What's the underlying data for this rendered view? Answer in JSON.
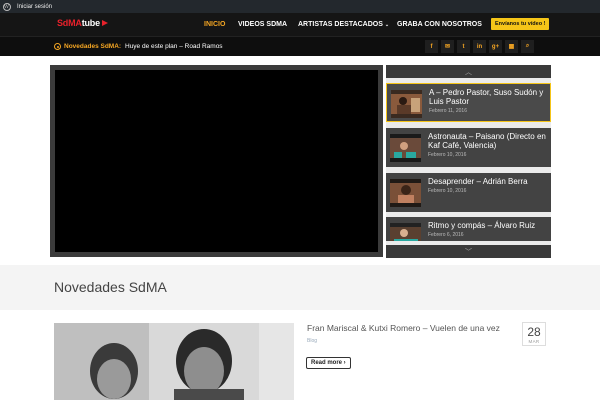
{
  "adminbar": {
    "login": "Iniciar sesión",
    "icon": "wordpress-icon"
  },
  "header": {
    "logo_a": "SdMA",
    "logo_b": "tube",
    "nav": [
      {
        "label": "INICIO",
        "active": true
      },
      {
        "label": "VIDEOS SDMA",
        "active": false
      },
      {
        "label": "ARTISTAS DESTACADOS",
        "active": false,
        "dropdown": true
      },
      {
        "label": "GRABA CON NOSOTROS",
        "active": false
      }
    ],
    "cta": "Envíanos tu vídeo !"
  },
  "ticker": {
    "label": "Novedades SdMA:",
    "text": "Huye de este plan – Road Ramos",
    "social": [
      {
        "icon": "facebook-icon",
        "glyph": "f"
      },
      {
        "icon": "mail-icon",
        "glyph": "✉"
      },
      {
        "icon": "twitter-icon",
        "glyph": "t"
      },
      {
        "icon": "linkedin-icon",
        "glyph": "in"
      },
      {
        "icon": "google-plus-icon",
        "glyph": "g+"
      },
      {
        "icon": "grid-icon",
        "glyph": "▦"
      },
      {
        "icon": "search-icon",
        "glyph": "⌕"
      }
    ]
  },
  "playlist": {
    "up": "︿",
    "down": "﹀",
    "items": [
      {
        "title": "A – Pedro Pastor, Suso Sudón y Luis Pastor",
        "date": "Febrero 11, 2016"
      },
      {
        "title": "Astronauta – Paisano (Directo en Kaf Café, Valencia)",
        "date": "Febrero 10, 2016"
      },
      {
        "title": "Desaprender – Adrián Berra",
        "date": "Febrero 10, 2016"
      },
      {
        "title": "Ritmo y compás – Álvaro Ruiz",
        "date": "Febrero 6, 2016"
      }
    ]
  },
  "section": {
    "title": "Novedades SdMA"
  },
  "post": {
    "title": "Fran Mariscal & Kutxi Romero – Vuelen de una vez",
    "category": "Blog",
    "read_more": "Read more ›",
    "day": "28",
    "month": "MAR"
  }
}
